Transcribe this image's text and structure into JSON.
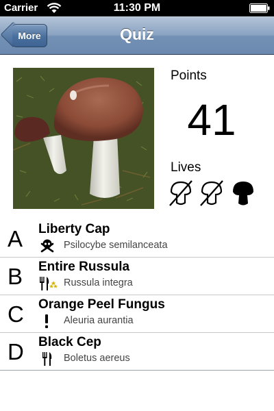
{
  "status_bar": {
    "carrier": "Carrier",
    "time": "11:30 PM",
    "icons": [
      "wifi-icon",
      "battery-icon"
    ]
  },
  "nav": {
    "back_label": "More",
    "title": "Quiz"
  },
  "score": {
    "points_label": "Points",
    "points_value": "41",
    "lives_label": "Lives",
    "lives": [
      {
        "state": "lost",
        "icon": "mushroom-crossed-icon"
      },
      {
        "state": "lost",
        "icon": "mushroom-crossed-icon"
      },
      {
        "state": "remaining",
        "icon": "mushroom-icon"
      }
    ]
  },
  "answers": [
    {
      "letter": "A",
      "name": "Liberty Cap",
      "latin": "Psilocybe semilanceata",
      "icon": "skull-crossbones-icon"
    },
    {
      "letter": "B",
      "name": "Entire Russula",
      "latin": "Russula integra",
      "icon": "fork-knife-stars-icon"
    },
    {
      "letter": "C",
      "name": "Orange Peel Fungus",
      "latin": "Aleuria aurantia",
      "icon": "exclamation-icon"
    },
    {
      "letter": "D",
      "name": "Black Cep",
      "latin": "Boletus aereus",
      "icon": "fork-knife-icon"
    }
  ],
  "colors": {
    "nav_bar": "#7391b5",
    "back_button": "#4a6f9d",
    "rating_star": "#d4b400"
  }
}
